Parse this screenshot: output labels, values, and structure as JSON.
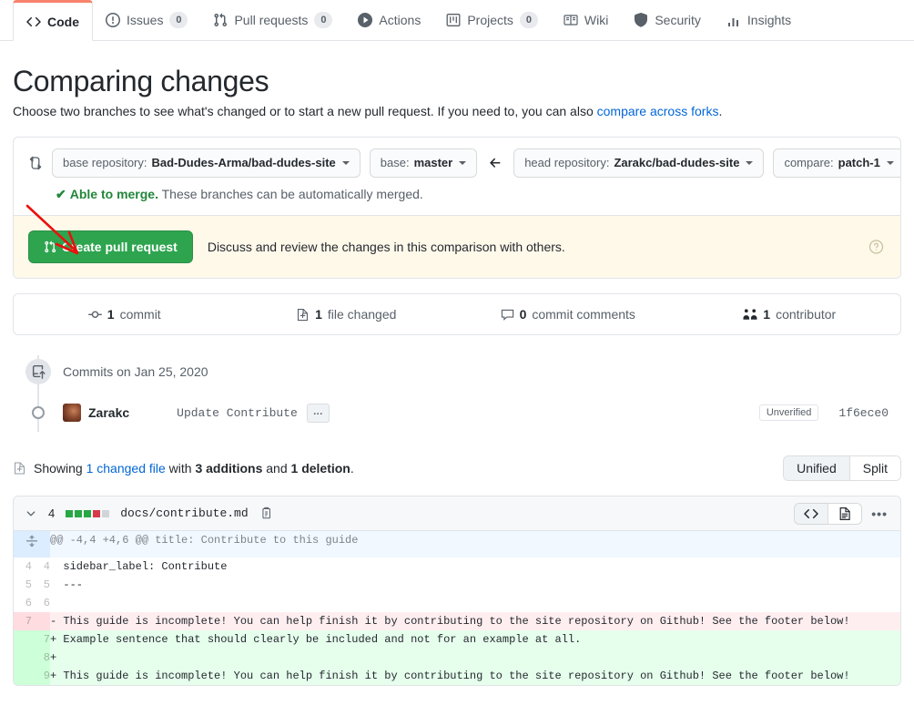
{
  "repo_nav": {
    "tabs": [
      {
        "label": "Code",
        "icon": "code-icon",
        "count": null,
        "selected": true
      },
      {
        "label": "Issues",
        "icon": "issue-icon",
        "count": "0",
        "selected": false
      },
      {
        "label": "Pull requests",
        "icon": "git-pull-icon",
        "count": "0",
        "selected": false
      },
      {
        "label": "Actions",
        "icon": "play-icon",
        "count": null,
        "selected": false
      },
      {
        "label": "Projects",
        "icon": "project-icon",
        "count": "0",
        "selected": false
      },
      {
        "label": "Wiki",
        "icon": "book-icon",
        "count": null,
        "selected": false
      },
      {
        "label": "Security",
        "icon": "shield-icon",
        "count": null,
        "selected": false
      },
      {
        "label": "Insights",
        "icon": "graph-icon",
        "count": null,
        "selected": false
      }
    ]
  },
  "heading": {
    "title": "Comparing changes",
    "subtitle_before": "Choose two branches to see what's changed or to start a new pull request. If you need to, you can also ",
    "subtitle_link": "compare across forks",
    "subtitle_after": "."
  },
  "compare": {
    "icon": "compare-icon",
    "base_repository": {
      "prefix": "base repository:",
      "value": "Bad-Dudes-Arma/bad-dudes-site"
    },
    "base_branch": {
      "prefix": "base:",
      "value": "master"
    },
    "direction_icon": "arrow-left-icon",
    "head_repository": {
      "prefix": "head repository:",
      "value": "Zarakc/bad-dudes-site"
    },
    "compare_branch": {
      "prefix": "compare:",
      "value": "patch-1"
    },
    "merge_status_strong": "Able to merge.",
    "merge_status_rest": " These branches can be automatically merged."
  },
  "cta": {
    "button_label": "Create pull request",
    "button_icon": "git-pull-request-icon",
    "button_color": "#2ea44f",
    "description": "Discuss and review the changes in this comparison with others.",
    "help_icon": "question-icon",
    "banner_color": "#fff9ea"
  },
  "stats": [
    {
      "icon": "commit-icon",
      "count": "1",
      "label": "commit"
    },
    {
      "icon": "file-diff-icon",
      "count": "1",
      "label": "file changed"
    },
    {
      "icon": "comment-icon",
      "count": "0",
      "label": "commit comments"
    },
    {
      "icon": "people-icon",
      "count": "1",
      "label": "contributor"
    }
  ],
  "commits": {
    "header_icon": "repo-push-icon",
    "header_text": "Commits on Jan 25, 2020",
    "rows": [
      {
        "author": "Zarakc",
        "message": "Update Contribute",
        "expand_label": "…",
        "verification": "Unverified",
        "sha": "1f6ece0"
      }
    ]
  },
  "showing": {
    "icon": "file-diff-icon",
    "prefix": "Showing ",
    "changed_file_link": "1 changed file",
    "middle": " with ",
    "additions": "3 additions",
    "conjunction": " and ",
    "deletions": "1 deletion",
    "suffix": ".",
    "view_modes": [
      {
        "label": "Unified",
        "active": true
      },
      {
        "label": "Split",
        "active": false
      }
    ]
  },
  "file": {
    "chevron_icon": "chevron-down-icon",
    "change_count": "4",
    "diffstat_blocks": [
      "add",
      "add",
      "add",
      "del",
      "none"
    ],
    "name": "docs/contribute.md",
    "copy_icon": "copy-path-icon",
    "actions": [
      {
        "icon": "code-icon",
        "name": "view-file-code-button",
        "active": true
      },
      {
        "icon": "file-icon",
        "name": "view-rendered-button",
        "active": false
      }
    ],
    "kebab_icon": "kebab-horizontal-icon",
    "diff_rows": [
      {
        "type": "hunk",
        "old": "",
        "new": "",
        "marker": "expand-icon",
        "code": "@@ -4,4 +4,6 @@ title: Contribute to this guide"
      },
      {
        "type": "ctx",
        "old": "4",
        "new": "4",
        "code": "  sidebar_label: Contribute"
      },
      {
        "type": "ctx",
        "old": "5",
        "new": "5",
        "code": "  ---"
      },
      {
        "type": "ctx",
        "old": "6",
        "new": "6",
        "code": "  "
      },
      {
        "type": "del",
        "old": "7",
        "new": "",
        "code": "- This guide is incomplete! You can help finish it by contributing to the site repository on Github! See the footer below!"
      },
      {
        "type": "add",
        "old": "",
        "new": "7",
        "code": "+ Example sentence that should clearly be included and not for an example at all."
      },
      {
        "type": "add",
        "old": "",
        "new": "8",
        "code": "+ "
      },
      {
        "type": "add",
        "old": "",
        "new": "9",
        "code": "+ This guide is incomplete! You can help finish it by contributing to the site repository on Github! See the footer below!"
      }
    ]
  },
  "annotation": {
    "type": "arrow",
    "color": "#e8110e",
    "points_to": "create-pull-request-button"
  }
}
